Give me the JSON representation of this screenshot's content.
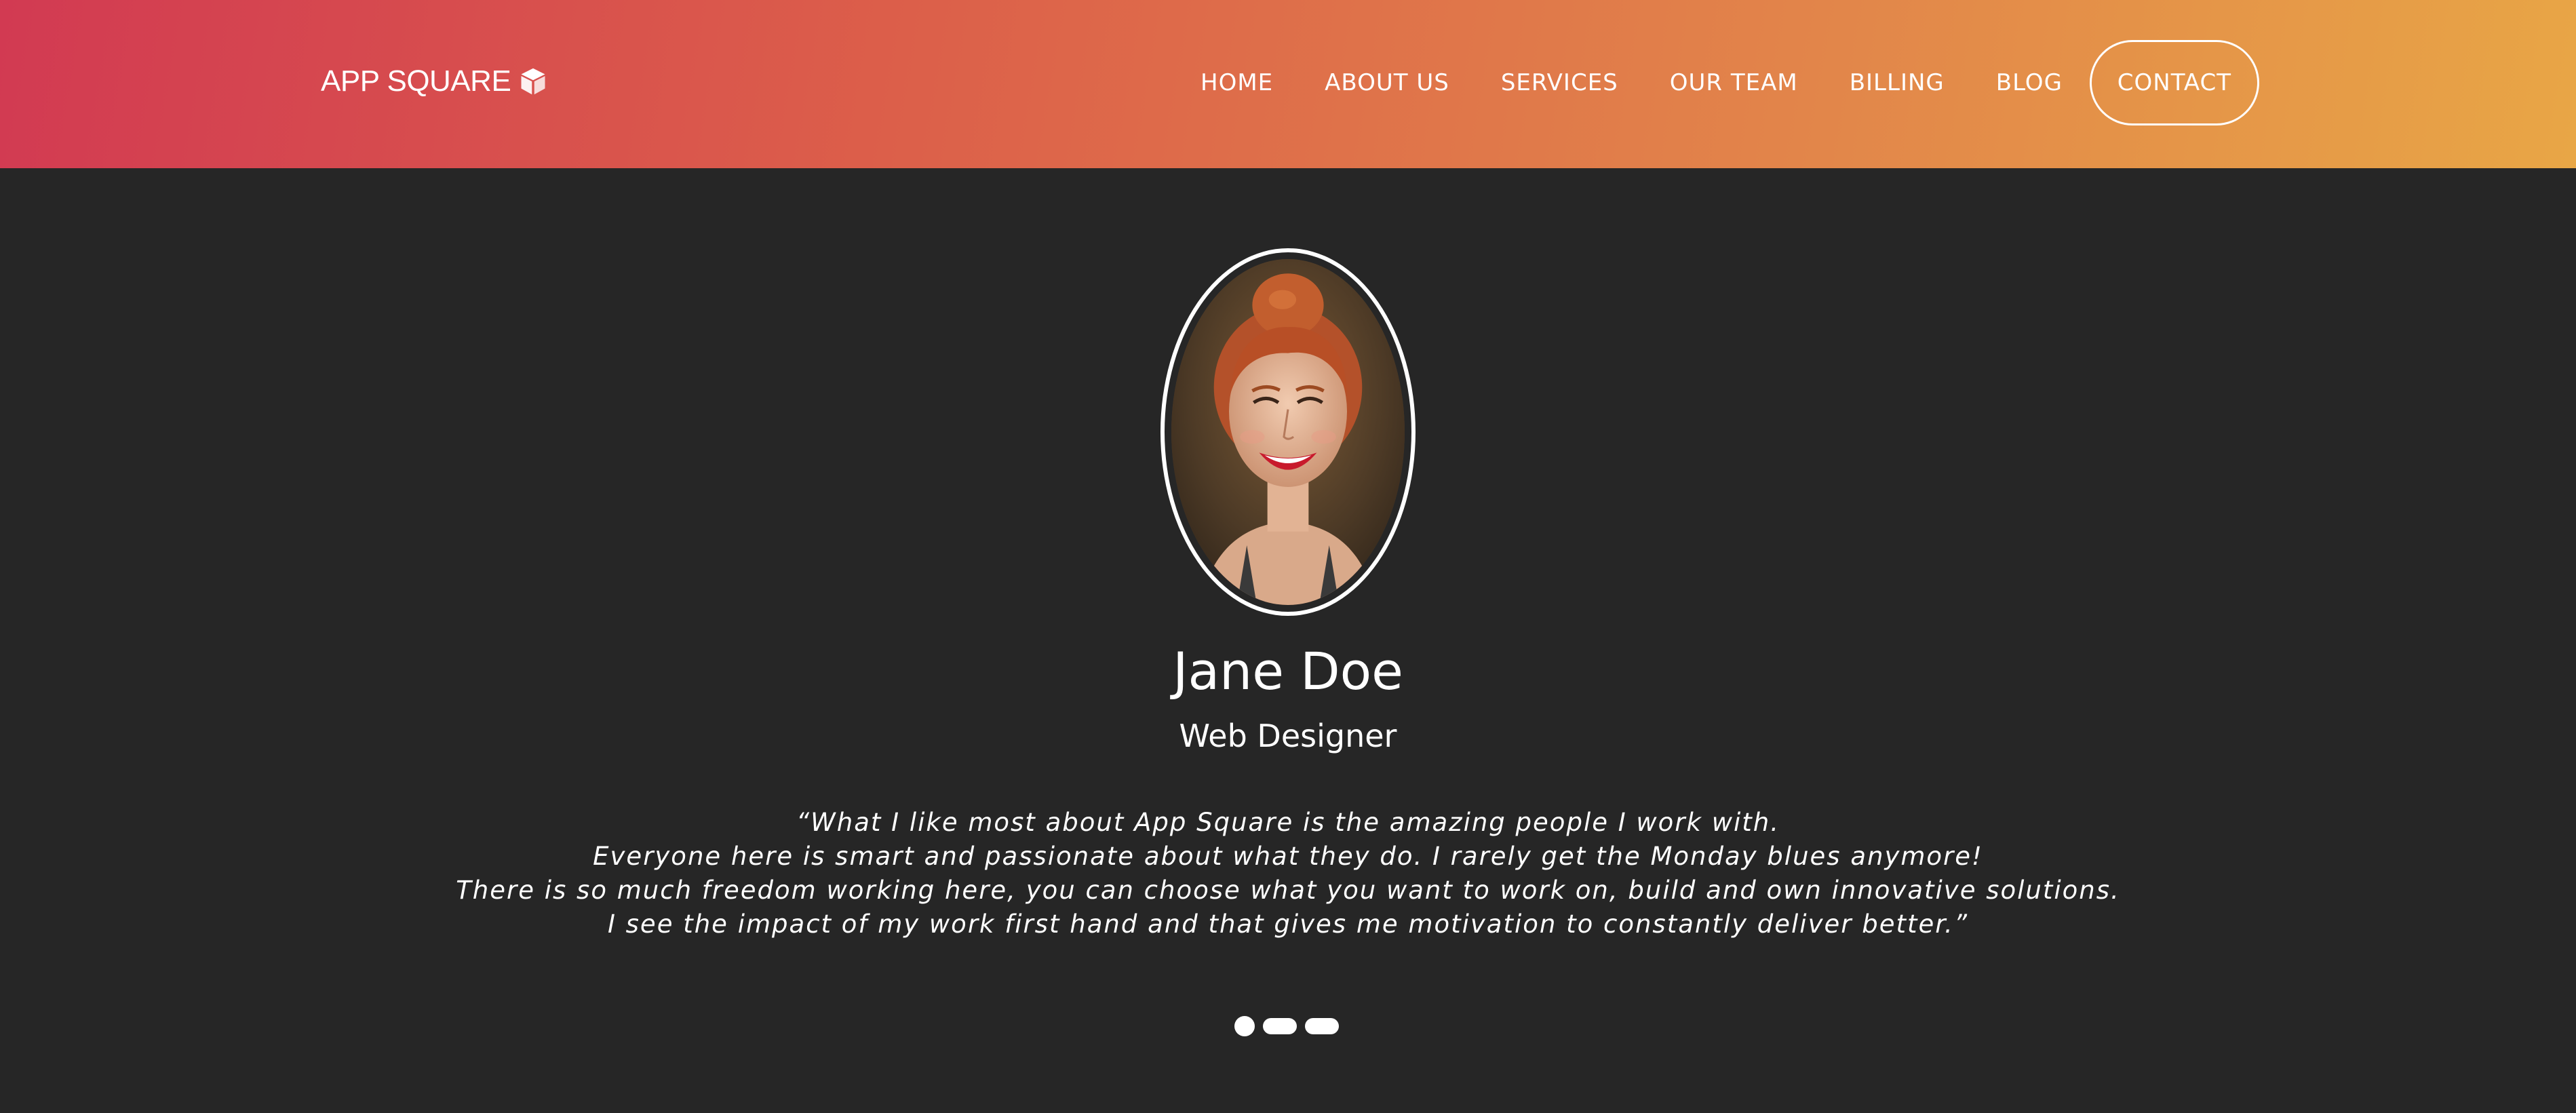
{
  "brand": {
    "name": "APP SQUARE",
    "icon": "cube-icon"
  },
  "nav": {
    "items": [
      "HOME",
      "ABOUT US",
      "SERVICES",
      "OUR TEAM",
      "BILLING",
      "BLOG"
    ],
    "contact_label": "CONTACT"
  },
  "colors": {
    "header_gradient_start": "#d23a52",
    "header_gradient_end": "#e8a646",
    "background": "#262626",
    "text": "#ffffff"
  },
  "testimonial": {
    "photo": "profile-photo",
    "name": "Jane Doe",
    "role": "Web Designer",
    "quote_lines": [
      "“What I like most about App Square is the amazing people I work with.",
      "Everyone here is smart and passionate about what they do. I rarely get the Monday blues anymore!",
      "There is so much freedom working here, you can choose what you want to work on, build and own innovative solutions.",
      "I see the impact of my work first hand and that gives me motivation to constantly deliver better.”"
    ]
  },
  "carousel": {
    "slide_count": 3,
    "active_index": 0
  }
}
